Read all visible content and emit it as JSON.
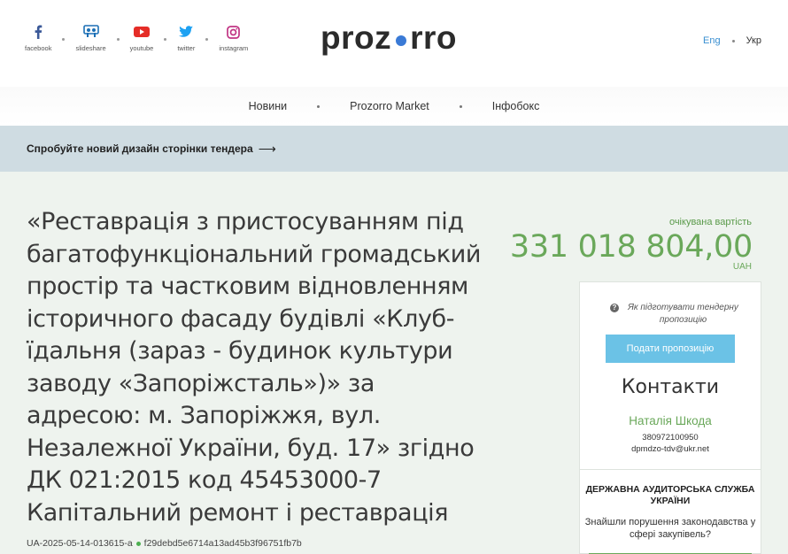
{
  "social": [
    {
      "name": "facebook-icon",
      "label": "facebook",
      "color": "#3b5998"
    },
    {
      "name": "slideshare-icon",
      "label": "slideshare",
      "color": "#1b6fb5"
    },
    {
      "name": "youtube-icon",
      "label": "youtube",
      "color": "#e52d27"
    },
    {
      "name": "twitter-icon",
      "label": "twitter",
      "color": "#1da1f2"
    },
    {
      "name": "instagram-icon",
      "label": "instagram",
      "color": "#c13584"
    }
  ],
  "logo": {
    "left": "proz",
    "right": "rro",
    "dot_color": "#3a7ad6"
  },
  "lang": {
    "en": "Eng",
    "uk": "Укр"
  },
  "nav": [
    "Новини",
    "Prozorro Market",
    "Інфобокс"
  ],
  "banner": {
    "text": "Спробуйте новий дизайн сторінки тендера",
    "arrow": "⟶"
  },
  "tender": {
    "title": "«Реставрація з пристосуванням під багатофункціональний громадський простір та частковим відновленням історичного фасаду будівлі «Клуб-їдальня (зараз - будинок культури заводу «Запоріжсталь»)» за адресою: м. Запоріжжя, вул. Незалежної України, буд. 17» згідно ДК 021:2015 код 45453000-7 Капітальний ремонт і реставрація",
    "id": "UA-2025-05-14-013615-a",
    "hash": "f29debd5e6714a13ad45b3f96751fb7b"
  },
  "expected": {
    "label": "очікувана вартість",
    "value": "331 018 804,00",
    "currency": "UAH"
  },
  "card": {
    "how_to": "Як підготувати тендерну пропозицію",
    "submit_label": "Подати пропозицію",
    "contacts_title": "Контакти",
    "contact_name": "Наталія Шкода",
    "contact_phone": "380972100950",
    "contact_email": "dpmdzo-tdv@ukr.net"
  },
  "audit": {
    "title": "ДЕРЖАВНА АУДИТОРСЬКА СЛУЖБА УКРАЇНИ",
    "text": "Знайшли порушення законодавства у сфері закупівель?"
  },
  "colors": {
    "accent_green": "#6aa85a",
    "button_blue": "#6bc2e6",
    "banner_bg": "#cfdce2"
  }
}
